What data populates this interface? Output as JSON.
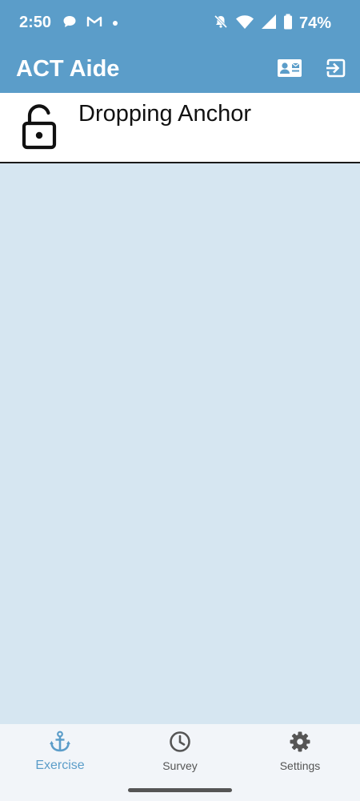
{
  "status_bar": {
    "time": "2:50",
    "battery": "74%",
    "icons": [
      "chat-bubble-icon",
      "gmail-icon",
      "dot-icon",
      "mute-icon",
      "wifi-icon",
      "signal-icon",
      "battery-icon"
    ]
  },
  "app_bar": {
    "title": "ACT Aide",
    "actions": [
      "contact-card-icon",
      "exit-icon"
    ]
  },
  "exercise_list": {
    "items": [
      {
        "title": "Dropping Anchor",
        "icon": "lock-open-icon"
      }
    ]
  },
  "bottom_nav": {
    "items": [
      {
        "label": "Exercise",
        "icon": "anchor-icon",
        "active": true
      },
      {
        "label": "Survey",
        "icon": "clock-icon",
        "active": false
      },
      {
        "label": "Settings",
        "icon": "gear-icon",
        "active": false
      }
    ]
  },
  "colors": {
    "primary": "#5b9dc9",
    "background": "#d6e6f1",
    "nav_background": "#f2f5f9",
    "list_item_background": "#ffffff"
  }
}
